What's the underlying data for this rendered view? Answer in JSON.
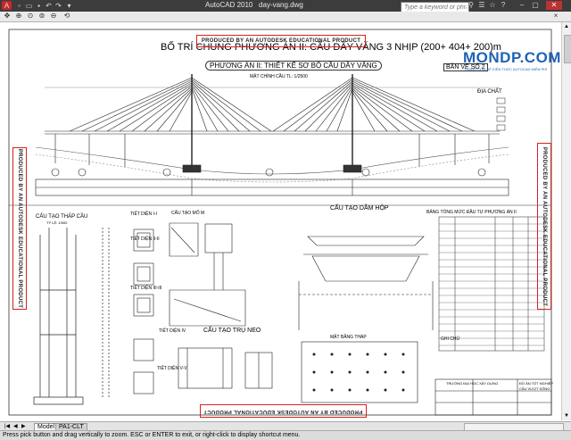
{
  "window": {
    "app_title": "AutoCAD 2010",
    "file_name": "day-vang.dwg",
    "search_placeholder": "Type a keyword or phrase"
  },
  "drawing": {
    "main_title": "BỐ TRÍ CHUNG PHƯƠNG ÁN II: CẦU DÂY VĂNG 3 NHỊP (200+ 404+ 200)m",
    "subtitle": "PHƯƠNG ÁN II: THIẾT KẾ SƠ BỘ CẦU DÂY VĂNG",
    "elevation_label": "MẶT CHÍNH CẦU TL: 1/2500",
    "plan_label": "BẢN VẼ SỐ 2",
    "geology_label": "ĐỊA CHẤT",
    "watermark": "PRODUCED BY AN AUTODESK EDUCATIONAL PRODUCT",
    "logo_text": "MONDP.COM",
    "logo_tagline": "TRANG CHIA SẺ KIẾN THỨC AUTOCAD MIỄN PHÍ",
    "sections": {
      "tower": "CẤU TẠO THÁP CẦU",
      "cross_section_1": "TIẾT DIỆN I-I",
      "cross_section_2": "TIẾT DIỆN II-II",
      "cross_section_3": "TIẾT DIỆN III-III",
      "cross_section_4": "TIẾT DIỆN IV",
      "cross_section_5": "TIẾT DIỆN V-V",
      "anchor": "CẤU TẠO MỐ M",
      "box_girder": "CẤU TẠO DẦM HỘP",
      "pier": "CẤU TẠO TRỤ NEO",
      "tower_plan": "MẶT BẰNG THÁP",
      "quantity_table": "BẢNG TỔNG MỨC ĐẦU TƯ PHƯƠNG ÁN II",
      "notes": "GHI CHÚ",
      "tower_scale": "TỶ LỆ: 1/500"
    },
    "title_block": {
      "university": "TRƯỜNG ĐẠI HỌC XÂY DỰNG",
      "project": "ĐỒ ÁN TỐT NGHIỆP",
      "bridge": "CẦU VƯỢT SÔNG"
    }
  },
  "tabs": [
    {
      "label": "Model"
    },
    {
      "label": "PA1-CLT"
    }
  ],
  "status_text": "Press pick button and drag vertically to zoom. ESC or ENTER to exit, or right-click to display shortcut menu.",
  "colors": {
    "titlebar": "#3c3c3c",
    "watermark_border": "#d82020",
    "logo_blue": "#1f63b5"
  }
}
